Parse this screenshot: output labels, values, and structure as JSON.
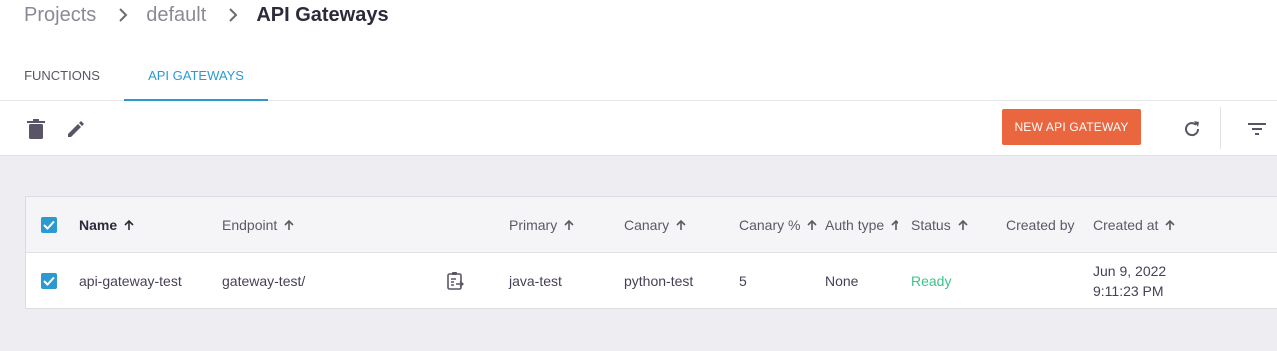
{
  "breadcrumb": {
    "items": [
      "Projects",
      "default"
    ],
    "current": "API Gateways"
  },
  "tabs": [
    {
      "label": "FUNCTIONS"
    },
    {
      "label": "API GATEWAYS"
    }
  ],
  "toolbar": {
    "new_button_label": "NEW API GATEWAY",
    "icons": [
      "delete-icon",
      "edit-icon",
      "refresh-icon",
      "filter-icon"
    ]
  },
  "table": {
    "columns": {
      "name": "Name",
      "endpoint": "Endpoint",
      "primary": "Primary",
      "canary": "Canary",
      "canary_pct": "Canary %",
      "auth_type": "Auth type",
      "status": "Status",
      "created_by": "Created by",
      "created_at": "Created at"
    },
    "rows": [
      {
        "name": "api-gateway-test",
        "endpoint": "gateway-test/",
        "primary": "java-test",
        "canary": "python-test",
        "canary_pct": "5",
        "auth_type": "None",
        "status": "Ready",
        "created_by": "",
        "created_at_date": "Jun 9, 2022",
        "created_at_time": "9:11:23 PM"
      }
    ]
  },
  "colors": {
    "accent": "#2a9ad1",
    "primary_button": "#e9663f",
    "status_ready": "#3ec28a"
  }
}
